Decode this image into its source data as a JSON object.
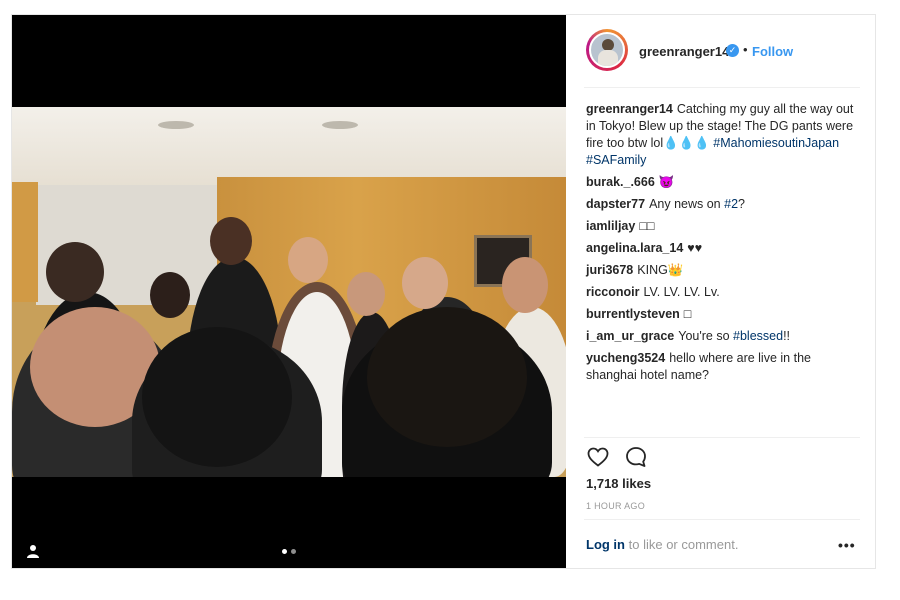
{
  "post": {
    "header": {
      "username": "greenranger14",
      "verified_icon": "verified-badge-icon",
      "separator": "•",
      "follow_label": "Follow"
    },
    "comments": [
      {
        "user": "greenranger14",
        "text": "Catching my guy all the way out in Tokyo! Blew up the stage! The DG pants were fire too btw lol💧💧💧",
        "tags": [
          "#MahomiesoutinJapan",
          "#SAFamily"
        ]
      },
      {
        "user": "burak._.666",
        "text": "😈"
      },
      {
        "user": "dapster77",
        "text": "Any news on",
        "link": "#2",
        "after": "?"
      },
      {
        "user": "iamliljay",
        "text": "□□"
      },
      {
        "user": "angelina.lara_14",
        "text": "♥♥"
      },
      {
        "user": "juri3678",
        "text": "KING👑"
      },
      {
        "user": "ricconoir",
        "text": "LV. LV. LV. Lv."
      },
      {
        "user": "burrentlysteven",
        "text": "□"
      },
      {
        "user": "i_am_ur_grace",
        "text": "You're so",
        "link": "#blessed",
        "after": "!!"
      },
      {
        "user": "yucheng3524",
        "text": "hello where are live in the shanghai hotel name?"
      }
    ],
    "actions": {
      "like_icon": "heart-icon",
      "comment_icon": "comment-bubble-icon"
    },
    "likes": "1,718 likes",
    "time_ago": "1 HOUR AGO",
    "login": {
      "link": "Log in",
      "rest": "to like or comment."
    },
    "more_label": "•••",
    "carousel": {
      "count": 2,
      "active": 1
    },
    "colors": {
      "accent": "#3897f0",
      "hashtag": "#003569",
      "muted": "#999999"
    }
  }
}
